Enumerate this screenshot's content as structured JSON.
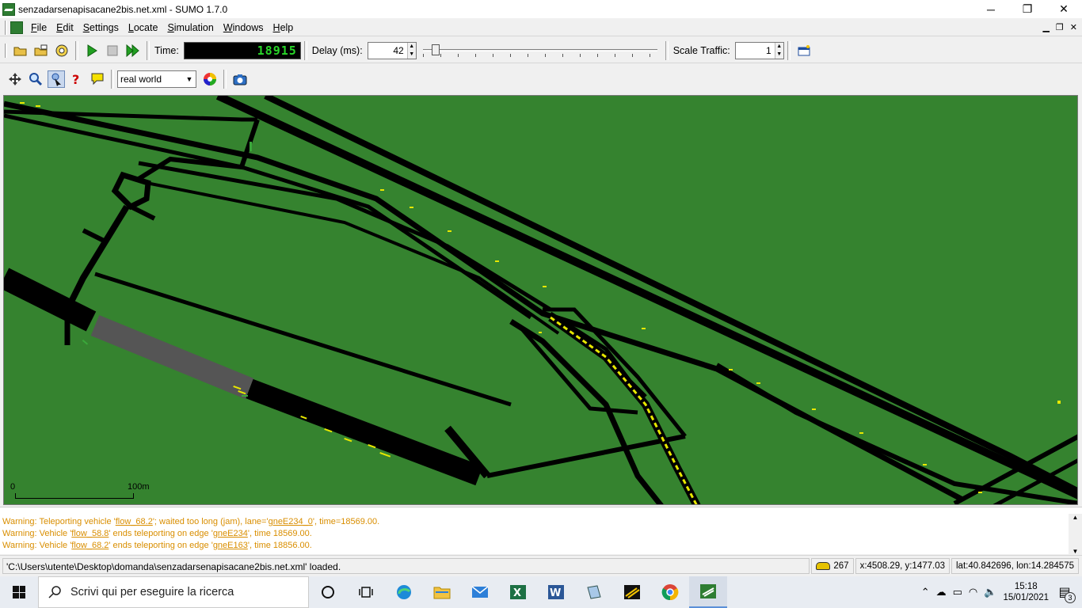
{
  "window": {
    "title": "senzadarsenapisacane2bis.net.xml - SUMO 1.7.0",
    "minimize": "─",
    "maximize": "❐",
    "close": "✕"
  },
  "menu": {
    "items": [
      "File",
      "Edit",
      "Settings",
      "Locate",
      "Simulation",
      "Windows",
      "Help"
    ],
    "mdi_min": "▁",
    "mdi_restore": "❐",
    "mdi_close": "✕"
  },
  "toolbar": {
    "time_label": "Time:",
    "time_value": "18915",
    "delay_label": "Delay (ms):",
    "delay_value": "42",
    "delay_slider_fraction": 0.04,
    "scale_label": "Scale Traffic:",
    "scale_value": "1"
  },
  "view_toolbar": {
    "scheme": "real world"
  },
  "map": {
    "scale_zero": "0",
    "scale_length": "100m",
    "background_color": "#35832f",
    "road_color": "#000000",
    "vehicle_color": "#ffff00"
  },
  "messages": [
    {
      "pre": "Warning: Teleporting vehicle '",
      "link1": "flow_68.2",
      "mid": "'; waited too long (jam), lane='",
      "link2": "gneE234_0",
      "post": "', time=18569.00."
    },
    {
      "pre": "Warning: Vehicle '",
      "link1": "flow_58.8",
      "mid": "' ends teleporting on edge '",
      "link2": "gneE234",
      "post": "', time 18569.00."
    },
    {
      "pre": "Warning: Vehicle '",
      "link1": "flow_68.2",
      "mid": "' ends teleporting on edge '",
      "link2": "gneE163",
      "post": "', time 18856.00."
    }
  ],
  "status": {
    "text": "'C:\\Users\\utente\\Desktop\\domanda\\senzadarsenapisacane2bis.net.xml' loaded.",
    "vehicle_count": "267",
    "coords": "x:4508.29, y:1477.03",
    "geo": "lat:40.842696, lon:14.284575"
  },
  "taskbar": {
    "search_placeholder": "Scrivi qui per eseguire la ricerca",
    "time": "15:18",
    "date": "15/01/2021",
    "notification_count": "3"
  }
}
